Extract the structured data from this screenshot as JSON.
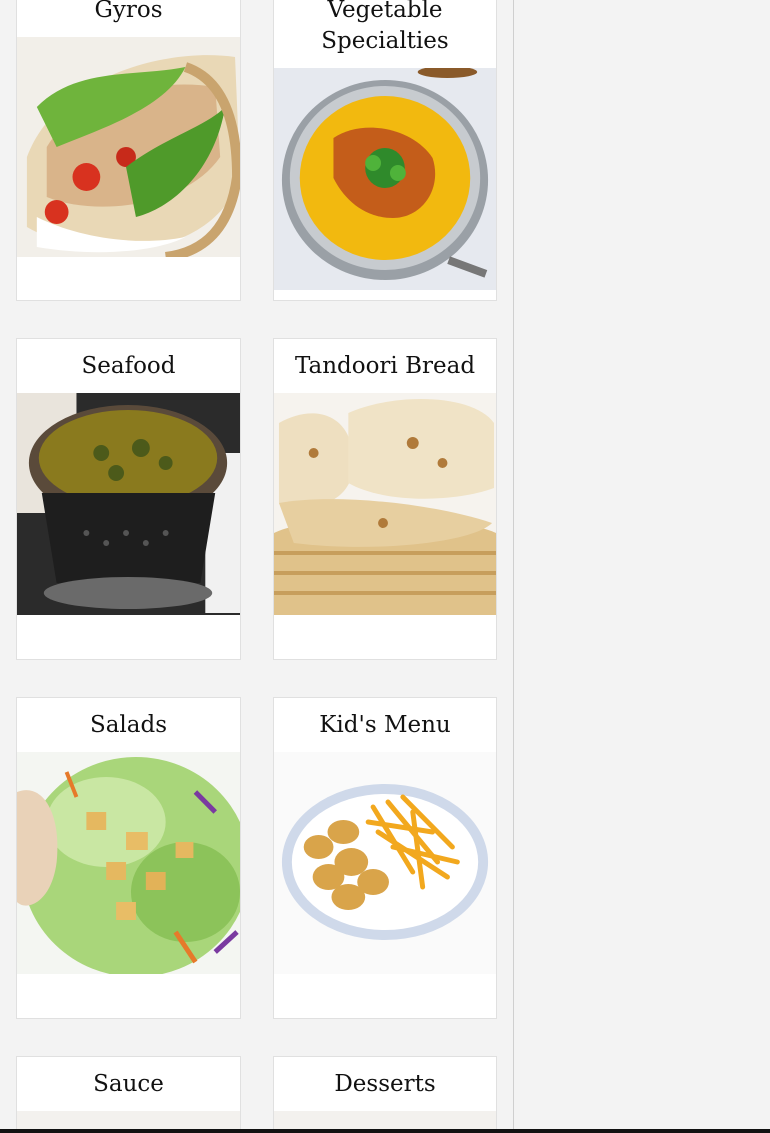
{
  "categories": [
    {
      "label": "Gyros"
    },
    {
      "label": "Vegetable Specialties"
    },
    {
      "label": "Seafood"
    },
    {
      "label": "Tandoori Bread"
    },
    {
      "label": "Salads"
    },
    {
      "label": "Kid's Menu"
    },
    {
      "label": "Sauce"
    },
    {
      "label": "Desserts"
    }
  ]
}
